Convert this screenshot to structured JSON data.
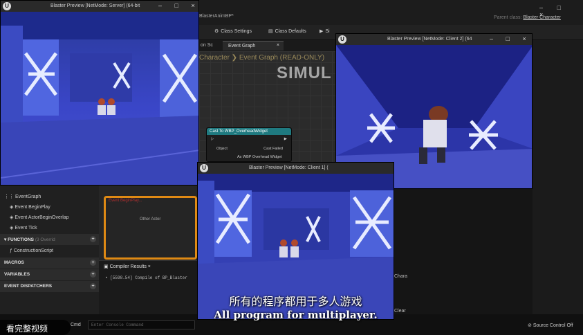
{
  "editor": {
    "title": "BlasterAnimBP*",
    "parent_class_label": "Parent class:",
    "parent_class_value": "Blaster Character",
    "win_controls": "– □ ×",
    "toolbar": [
      {
        "icon": "gear-icon",
        "label": "Class Settings"
      },
      {
        "icon": "class-defaults-icon",
        "label": "Class Defaults"
      },
      {
        "icon": "simulate-icon",
        "label": "Si"
      }
    ],
    "tab_left": "on Sc",
    "tab_event_graph": "Event Graph",
    "tab_close": "×",
    "breadcrumb": "Character ❯ Event Graph  (READ-ONLY)",
    "watermark": "SIMUL",
    "cast_node": {
      "title": "Cast To WBP_OverheadWidget",
      "pin_object": "Object",
      "pin_cast_failed": "Cast Failed",
      "pin_as": "As WBP Overhead Widget"
    },
    "orange_node_title": "Event BeginPlay...",
    "other_actor": "Other Actor"
  },
  "left_panel": {
    "items": [
      {
        "label": "EventGraph",
        "kind": "graph"
      },
      {
        "label": "Event BeginPlay",
        "kind": "event"
      },
      {
        "label": "Event ActorBeginOverlap",
        "kind": "event"
      },
      {
        "label": "Event Tick",
        "kind": "event"
      }
    ],
    "sections": [
      {
        "label": "FUNCTIONS",
        "suffix": "(3 Overrid"
      },
      {
        "label": "MACROS"
      },
      {
        "label": "VARIABLES"
      },
      {
        "label": "EVENT DISPATCHERS"
      }
    ],
    "construction_script": "ConstructionScript"
  },
  "compiler": {
    "tab": "Compiler Results",
    "log": "• [5598.54] Compile of BP_Blaster"
  },
  "status": {
    "cmd": "Cmd",
    "console_placeholder": "Enter Console Command",
    "source_control": "Source Control Off",
    "clear": "Clear",
    "chara": "Chara"
  },
  "windows": {
    "server": {
      "title": "Blaster Preview [NetMode: Server]  (64-bit",
      "controls": "– □ ×"
    },
    "client2": {
      "title": "Blaster Preview [NetMode: Client 2]  (64",
      "controls": "– □ ×"
    },
    "client1": {
      "title": "Blaster Preview [NetMode: Client 1]  (",
      "controls": ""
    }
  },
  "subtitle": {
    "cn": "所有的程序都用于多人游戏",
    "en": "All program for multiplayer."
  },
  "watch_button": "看完整视频"
}
